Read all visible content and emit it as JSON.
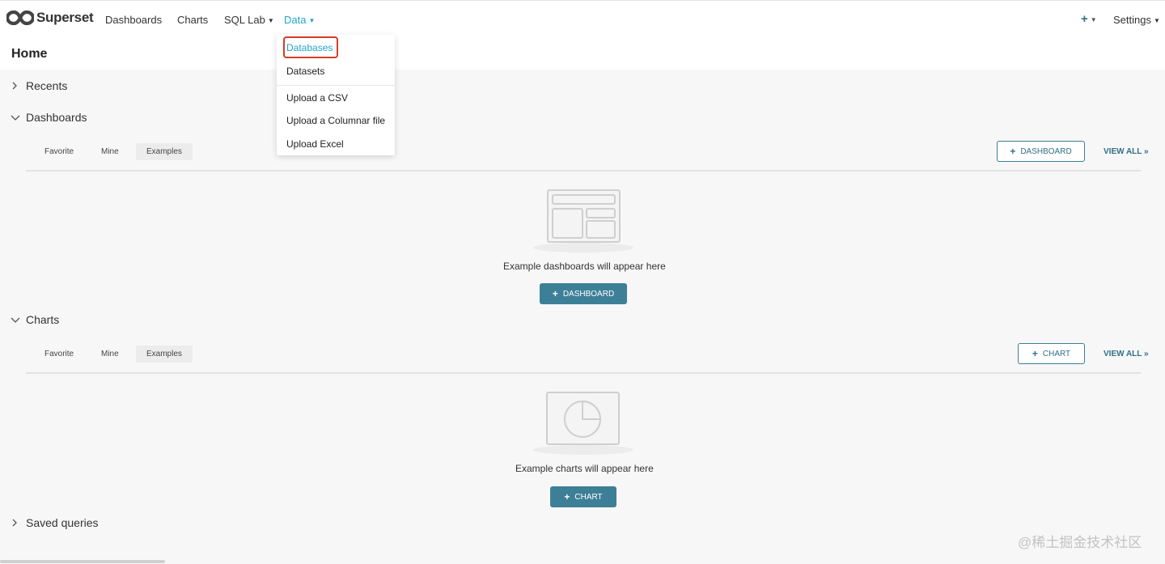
{
  "navbar": {
    "brand": "Superset",
    "items": [
      {
        "label": "Dashboards"
      },
      {
        "label": "Charts"
      },
      {
        "label": "SQL Lab"
      },
      {
        "label": "Data"
      }
    ],
    "settings_label": "Settings",
    "icons": {
      "logo": "infinity-logo-icon",
      "add": "plus-icon",
      "caret": "caret-down-icon"
    }
  },
  "page_title": "Home",
  "data_menu": {
    "items": [
      "Databases",
      "Datasets",
      "Upload a CSV",
      "Upload a Columnar file",
      "Upload Excel"
    ],
    "highlighted": "Databases"
  },
  "sections": {
    "recents": {
      "title": "Recents"
    },
    "dashboards": {
      "title": "Dashboards",
      "tabs": [
        "Favorite",
        "Mine",
        "Examples"
      ],
      "selected_tab": "Examples",
      "add_button": "DASHBOARD",
      "view_all": "VIEW ALL »",
      "empty_text": "Example dashboards will appear here",
      "empty_button": "DASHBOARD"
    },
    "charts": {
      "title": "Charts",
      "tabs": [
        "Favorite",
        "Mine",
        "Examples"
      ],
      "selected_tab": "Examples",
      "add_button": "CHART",
      "view_all": "VIEW ALL »",
      "empty_text": "Example charts will appear here",
      "empty_button": "CHART"
    },
    "saved_queries": {
      "title": "Saved queries"
    }
  },
  "watermark": "@稀土掘金技术社区",
  "colors": {
    "accent": "#20a7c9",
    "primary_button": "#3e7f98",
    "highlight_box": "#d63c26"
  }
}
